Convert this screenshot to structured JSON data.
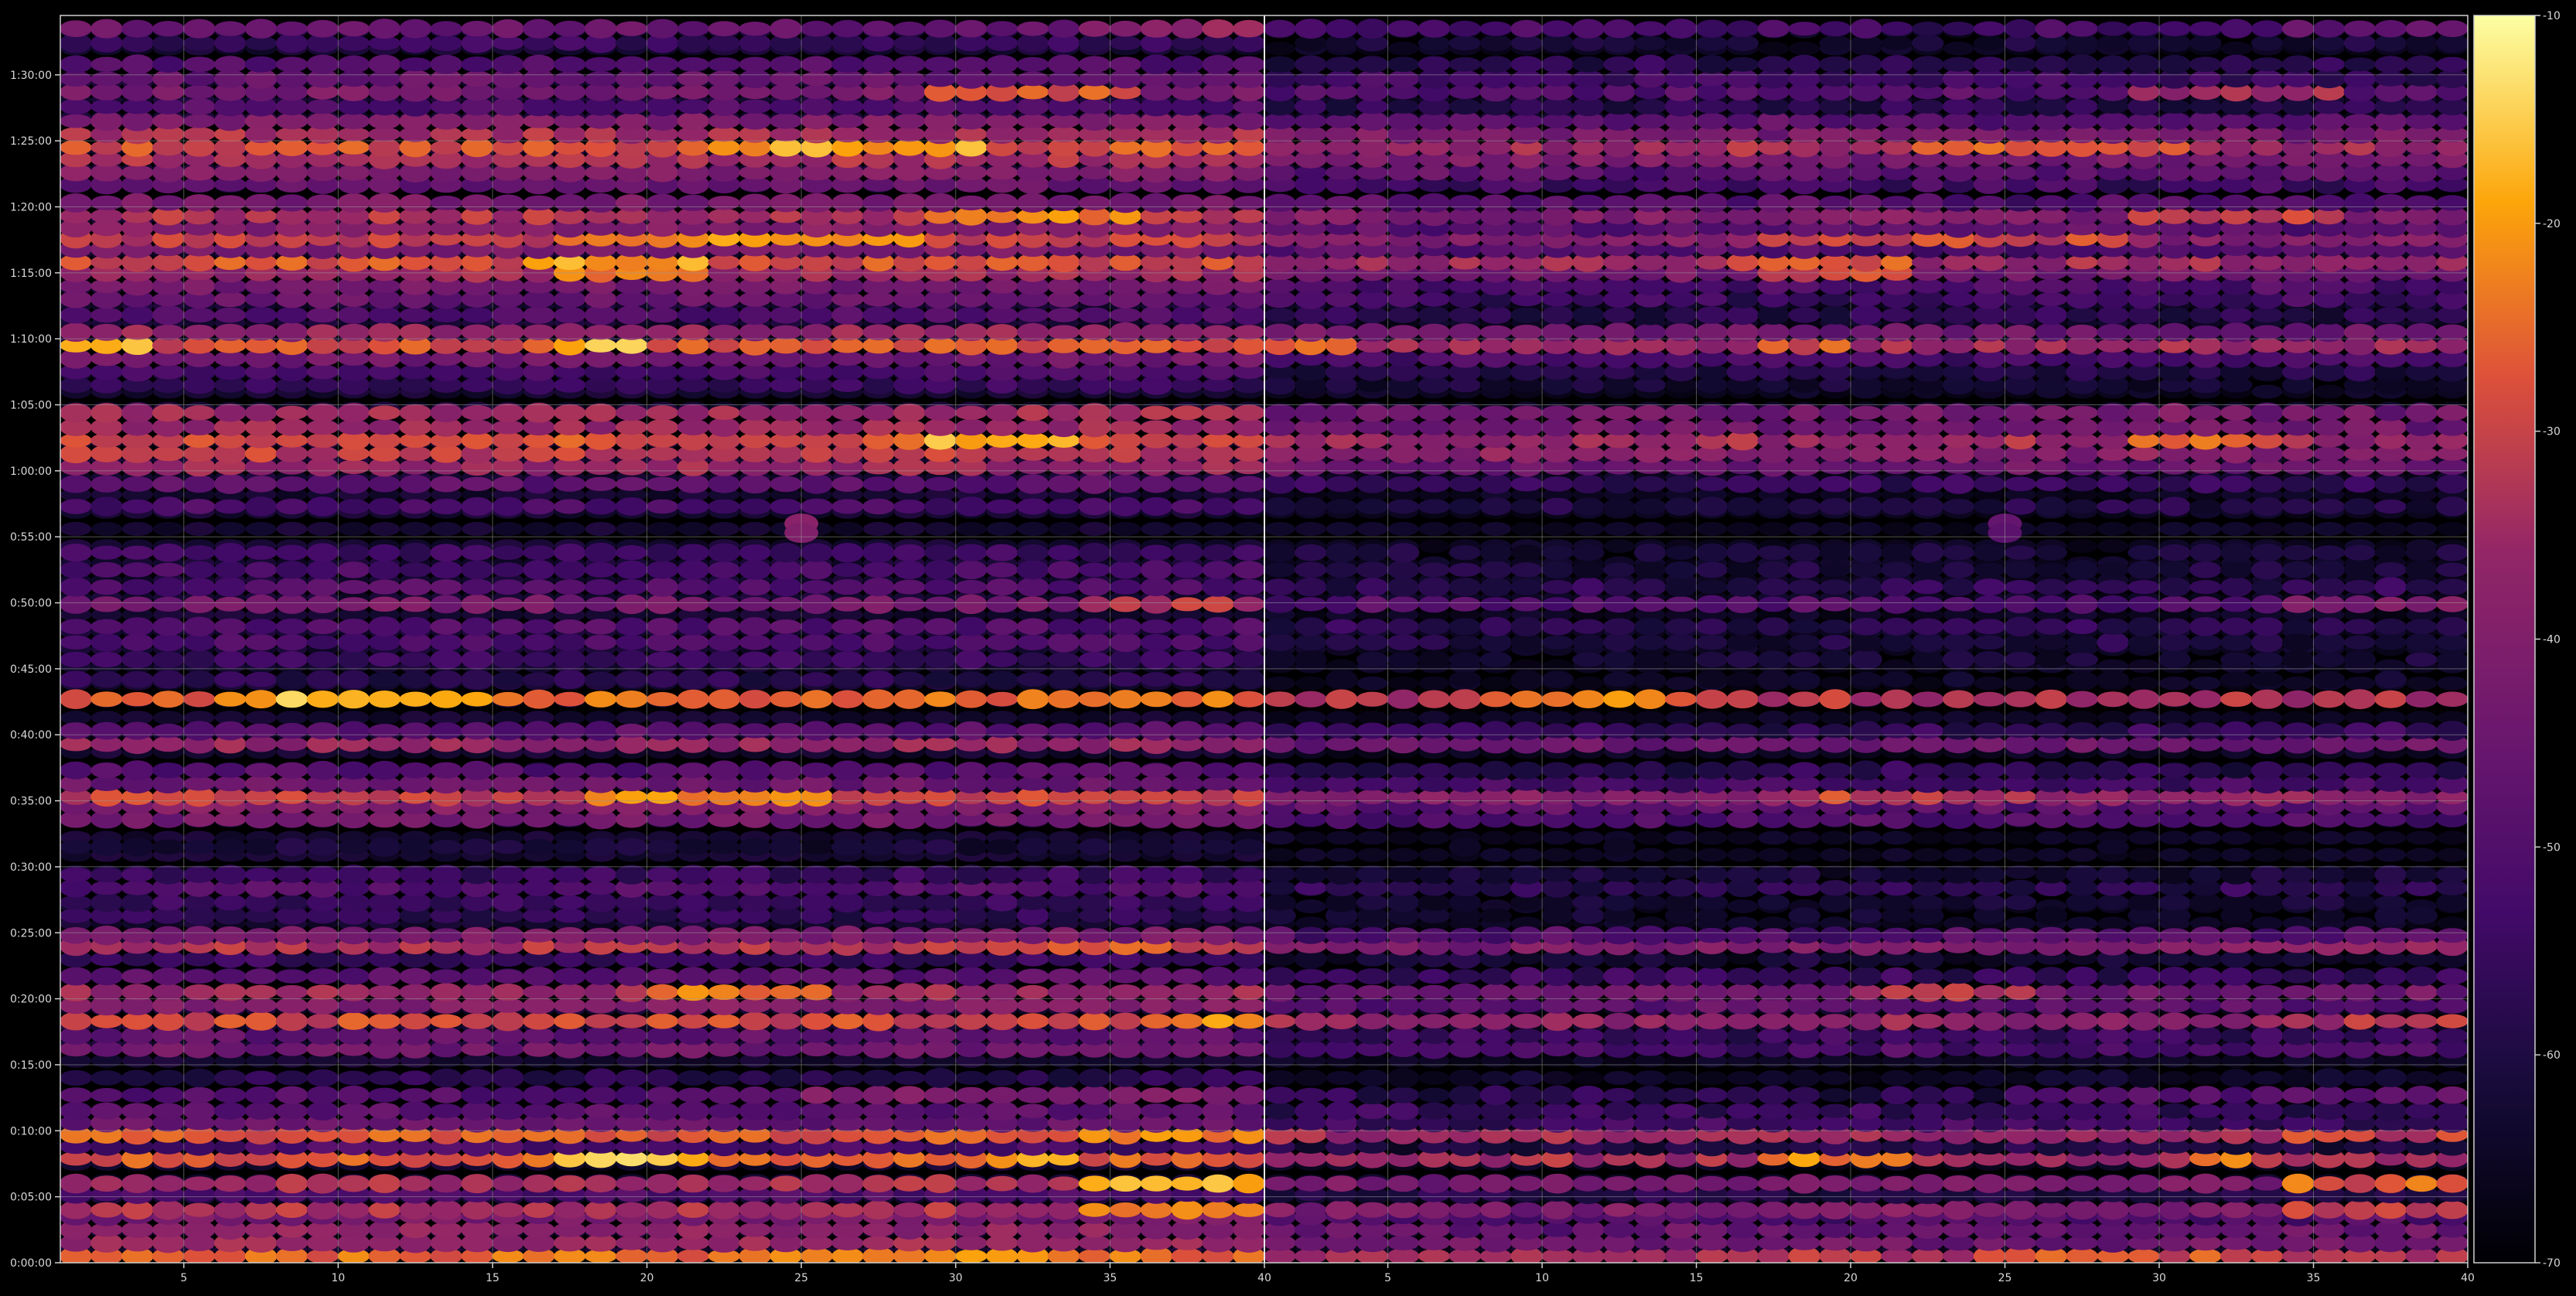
{
  "chart_data": {
    "type": "heatmap",
    "title": "",
    "xlabel": "",
    "ylabel": "",
    "panels": [
      {
        "name": "",
        "xlim": [
          1,
          40
        ],
        "x_ticks": [
          5,
          10,
          15,
          20,
          25,
          30,
          35,
          40
        ]
      },
      {
        "name": "",
        "xlim": [
          1,
          40
        ],
        "x_ticks": [
          5,
          10,
          15,
          20,
          25,
          30,
          35,
          40
        ]
      }
    ],
    "y_ticks": [
      "0:00:00",
      "0:05:00",
      "0:10:00",
      "0:15:00",
      "0:20:00",
      "0:25:00",
      "0:30:00",
      "0:35:00",
      "0:40:00",
      "0:45:00",
      "0:50:00",
      "0:55:00",
      "1:00:00",
      "1:05:00",
      "1:10:00",
      "1:15:00",
      "1:20:00",
      "1:25:00",
      "1:30:00"
    ],
    "ylim_minutes": [
      0,
      94.5
    ],
    "colorbar": {
      "colormap": "inferno",
      "range": [
        -70,
        -10
      ],
      "ticks": [
        -10,
        -20,
        -30,
        -40,
        -50,
        -60,
        -70
      ]
    },
    "grid": true,
    "bands": [
      {
        "t": 0.5,
        "level": -25,
        "x": [
          [
            1,
            40,
            -25
          ],
          [
            24,
            34,
            -20
          ]
        ]
      },
      {
        "t": 1.5,
        "level": -35,
        "x": [
          [
            1,
            40,
            -36
          ]
        ]
      },
      {
        "t": 2.5,
        "level": -38,
        "x": [
          [
            1,
            40,
            -38
          ]
        ]
      },
      {
        "t": 3.5,
        "level": -42,
        "x": [
          [
            1,
            40,
            -42
          ]
        ]
      },
      {
        "t": 4,
        "level": -32,
        "x": [
          [
            1,
            40,
            -33
          ],
          [
            34,
            40,
            -22
          ]
        ]
      },
      {
        "t": 5.2,
        "level": -50,
        "x": [
          [
            1,
            40,
            -51
          ]
        ]
      },
      {
        "t": 6,
        "level": -32,
        "x": [
          [
            1,
            40,
            -34
          ],
          [
            34,
            40,
            -18
          ]
        ]
      },
      {
        "t": 7.9,
        "level": -23,
        "x": [
          [
            1,
            40,
            -27
          ],
          [
            17,
            22,
            -16
          ],
          [
            31,
            34,
            -18
          ]
        ]
      },
      {
        "t": 8.8,
        "level": -50,
        "x": [
          [
            1,
            40,
            -52
          ]
        ]
      },
      {
        "t": 9.7,
        "level": -26,
        "x": [
          [
            1,
            40,
            -27
          ],
          [
            34,
            40,
            -22
          ]
        ]
      },
      {
        "t": 10.6,
        "level": -45,
        "x": [
          [
            1,
            40,
            -46
          ]
        ]
      },
      {
        "t": 11.5,
        "level": -48,
        "x": [
          [
            1,
            40,
            -48
          ]
        ]
      },
      {
        "t": 12.7,
        "level": -50,
        "x": [
          [
            1,
            40,
            -50
          ],
          [
            25,
            40,
            -40
          ]
        ]
      },
      {
        "t": 14,
        "level": -58,
        "x": [
          [
            1,
            40,
            -58
          ]
        ]
      },
      {
        "t": 16.2,
        "level": -43,
        "x": [
          [
            1,
            40,
            -44
          ]
        ]
      },
      {
        "t": 17.2,
        "level": -47,
        "x": [
          [
            1,
            40,
            -47
          ]
        ]
      },
      {
        "t": 18.3,
        "level": -28,
        "x": [
          [
            1,
            40,
            -29
          ],
          [
            36,
            40,
            -22
          ]
        ]
      },
      {
        "t": 19.5,
        "level": -38,
        "x": [
          [
            1,
            40,
            -40
          ]
        ]
      },
      {
        "t": 20.5,
        "level": -35,
        "x": [
          [
            1,
            40,
            -36
          ],
          [
            20,
            26,
            -24
          ]
        ]
      },
      {
        "t": 21.7,
        "level": -48,
        "x": [
          [
            1,
            40,
            -48
          ]
        ]
      },
      {
        "t": 23,
        "level": -55,
        "x": [
          [
            1,
            40,
            -55
          ]
        ]
      },
      {
        "t": 24,
        "level": -33,
        "x": [
          [
            1,
            40,
            -33
          ],
          [
            30,
            40,
            -28
          ]
        ]
      },
      {
        "t": 24.8,
        "level": -40,
        "x": [
          [
            1,
            40,
            -42
          ]
        ]
      },
      {
        "t": 26.3,
        "level": -57,
        "x": [
          [
            1,
            40,
            -57
          ]
        ]
      },
      {
        "t": 27.3,
        "level": -55,
        "x": [
          [
            1,
            40,
            -55
          ]
        ]
      },
      {
        "t": 28.4,
        "level": -48,
        "x": [
          [
            1,
            40,
            -50
          ]
        ]
      },
      {
        "t": 29.4,
        "level": -55,
        "x": [
          [
            1,
            40,
            -55
          ]
        ]
      },
      {
        "t": 31.5,
        "level": -62,
        "x": [
          [
            1,
            40,
            -62
          ]
        ]
      },
      {
        "t": 33.6,
        "level": -42,
        "x": [
          [
            1,
            40,
            -43
          ]
        ]
      },
      {
        "t": 34.6,
        "level": -38,
        "x": [
          [
            1,
            40,
            -40
          ]
        ]
      },
      {
        "t": 35.3,
        "level": -28,
        "x": [
          [
            1,
            40,
            -30
          ],
          [
            18,
            26,
            -22
          ]
        ]
      },
      {
        "t": 36.3,
        "level": -45,
        "x": [
          [
            1,
            40,
            -45
          ]
        ]
      },
      {
        "t": 37.3,
        "level": -50,
        "x": [
          [
            1,
            40,
            -50
          ]
        ]
      },
      {
        "t": 39.3,
        "level": -35,
        "x": [
          [
            1,
            40,
            -37
          ]
        ]
      },
      {
        "t": 40.3,
        "level": -48,
        "x": [
          [
            1,
            40,
            -48
          ]
        ]
      },
      {
        "t": 42.7,
        "level": -25,
        "x": [
          [
            1,
            40,
            -25
          ],
          [
            8,
            15,
            -15
          ]
        ]
      },
      {
        "t": 44.2,
        "level": -58,
        "x": [
          [
            1,
            40,
            -58
          ]
        ]
      },
      {
        "t": 45.7,
        "level": -55,
        "x": [
          [
            1,
            40,
            -55
          ]
        ]
      },
      {
        "t": 47,
        "level": -50,
        "x": [
          [
            1,
            40,
            -52
          ]
        ]
      },
      {
        "t": 48.2,
        "level": -50,
        "x": [
          [
            1,
            40,
            -50
          ]
        ]
      },
      {
        "t": 49.9,
        "level": -40,
        "x": [
          [
            1,
            40,
            -42
          ],
          [
            34,
            40,
            -32
          ]
        ]
      },
      {
        "t": 51.2,
        "level": -48,
        "x": [
          [
            1,
            40,
            -50
          ]
        ]
      },
      {
        "t": 52.5,
        "level": -50,
        "x": [
          [
            1,
            40,
            -52
          ]
        ]
      },
      {
        "t": 53.8,
        "level": -52,
        "x": [
          [
            1,
            40,
            -54
          ]
        ]
      },
      {
        "t": 57.3,
        "level": -50,
        "x": [
          [
            1,
            40,
            -52
          ]
        ]
      },
      {
        "t": 59,
        "level": -48,
        "x": [
          [
            1,
            40,
            -48
          ]
        ]
      },
      {
        "t": 60.3,
        "level": -35,
        "x": [
          [
            1,
            40,
            -36
          ]
        ]
      },
      {
        "t": 61.3,
        "level": -30,
        "x": [
          [
            1,
            40,
            -31
          ]
        ]
      },
      {
        "t": 62.3,
        "level": -26,
        "x": [
          [
            1,
            40,
            -28
          ],
          [
            29,
            34,
            -18
          ]
        ]
      },
      {
        "t": 63.3,
        "level": -35,
        "x": [
          [
            1,
            40,
            -36
          ]
        ]
      },
      {
        "t": 64.4,
        "level": -33,
        "x": [
          [
            1,
            40,
            -35
          ]
        ]
      },
      {
        "t": 66.5,
        "level": -55,
        "x": [
          [
            1,
            40,
            -55
          ]
        ]
      },
      {
        "t": 67.5,
        "level": -50,
        "x": [
          [
            1,
            40,
            -52
          ]
        ]
      },
      {
        "t": 68.5,
        "level": -42,
        "x": [
          [
            1,
            40,
            -44
          ]
        ]
      },
      {
        "t": 69.5,
        "level": -27,
        "x": [
          [
            1,
            40,
            -28
          ],
          [
            1,
            4,
            -18
          ],
          [
            17,
            20,
            -18
          ]
        ]
      },
      {
        "t": 70.5,
        "level": -36,
        "x": [
          [
            1,
            40,
            -37
          ]
        ]
      },
      {
        "t": 71.8,
        "level": -48,
        "x": [
          [
            1,
            40,
            -50
          ]
        ]
      },
      {
        "t": 73,
        "level": -45,
        "x": [
          [
            1,
            40,
            -46
          ]
        ]
      },
      {
        "t": 74,
        "level": -42,
        "x": [
          [
            1,
            40,
            -43
          ]
        ]
      },
      {
        "t": 75,
        "level": -35,
        "x": [
          [
            1,
            40,
            -36
          ],
          [
            17,
            22,
            -22
          ]
        ]
      },
      {
        "t": 75.8,
        "level": -28,
        "x": [
          [
            1,
            40,
            -28
          ],
          [
            16,
            22,
            -20
          ]
        ]
      },
      {
        "t": 76.8,
        "level": -40,
        "x": [
          [
            1,
            40,
            -42
          ]
        ]
      },
      {
        "t": 77.6,
        "level": -30,
        "x": [
          [
            1,
            40,
            -31
          ],
          [
            17,
            29,
            -22
          ]
        ]
      },
      {
        "t": 78.4,
        "level": -38,
        "x": [
          [
            1,
            40,
            -40
          ]
        ]
      },
      {
        "t": 79.3,
        "level": -33,
        "x": [
          [
            1,
            40,
            -33
          ],
          [
            29,
            36,
            -22
          ]
        ]
      },
      {
        "t": 80.3,
        "level": -40,
        "x": [
          [
            1,
            40,
            -42
          ]
        ]
      },
      {
        "t": 81.7,
        "level": -45,
        "x": [
          [
            1,
            40,
            -46
          ]
        ]
      },
      {
        "t": 82.6,
        "level": -38,
        "x": [
          [
            1,
            40,
            -40
          ]
        ]
      },
      {
        "t": 83.6,
        "level": -33,
        "x": [
          [
            1,
            40,
            -34
          ]
        ]
      },
      {
        "t": 84.5,
        "level": -27,
        "x": [
          [
            1,
            40,
            -28
          ],
          [
            22,
            31,
            -20
          ]
        ]
      },
      {
        "t": 85.5,
        "level": -33,
        "x": [
          [
            1,
            40,
            -34
          ]
        ]
      },
      {
        "t": 86.5,
        "level": -40,
        "x": [
          [
            1,
            40,
            -41
          ]
        ]
      },
      {
        "t": 87.6,
        "level": -48,
        "x": [
          [
            1,
            40,
            -50
          ]
        ]
      },
      {
        "t": 88.7,
        "level": -40,
        "x": [
          [
            1,
            40,
            -42
          ],
          [
            29,
            36,
            -28
          ]
        ]
      },
      {
        "t": 89.7,
        "level": -45,
        "x": [
          [
            1,
            40,
            -46
          ]
        ]
      },
      {
        "t": 90.8,
        "level": -48,
        "x": [
          [
            1,
            40,
            -50
          ]
        ]
      },
      {
        "t": 92.4,
        "level": -55,
        "x": [
          [
            1,
            40,
            -55
          ]
        ]
      },
      {
        "t": 93.5,
        "level": -45,
        "x": [
          [
            15,
            40,
            -46
          ],
          [
            34,
            40,
            -38
          ]
        ]
      }
    ],
    "spots": [
      {
        "t": 56,
        "x": 25,
        "value": -38
      },
      {
        "t": 55.3,
        "x": 25,
        "value": -40
      }
    ]
  }
}
